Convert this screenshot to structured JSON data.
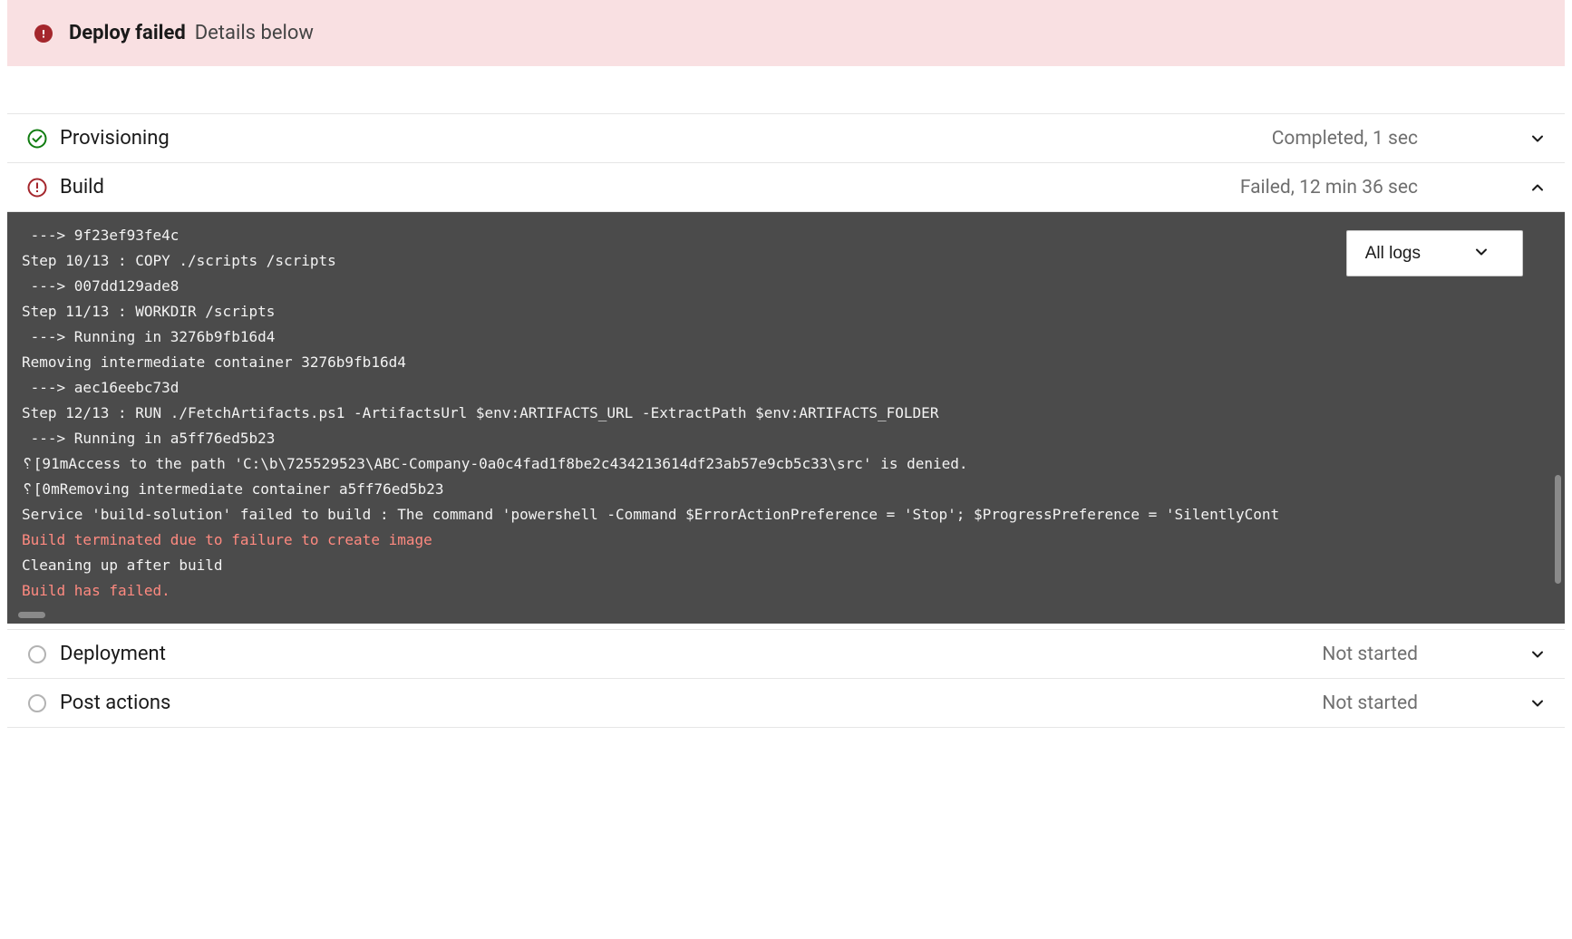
{
  "alert": {
    "title": "Deploy failed",
    "subtitle": "Details below"
  },
  "stages": {
    "provisioning": {
      "name": "Provisioning",
      "status": "Completed, 1 sec"
    },
    "build": {
      "name": "Build",
      "status": "Failed, 12 min 36 sec"
    },
    "deployment": {
      "name": "Deployment",
      "status": "Not started"
    },
    "postactions": {
      "name": "Post actions",
      "status": "Not started"
    }
  },
  "log_filter": {
    "selected": "All logs"
  },
  "log_lines": [
    {
      "t": " ---> 9f23ef93fe4c",
      "err": false
    },
    {
      "t": "Step 10/13 : COPY ./scripts /scripts",
      "err": false
    },
    {
      "t": " ---> 007dd129ade8",
      "err": false
    },
    {
      "t": "Step 11/13 : WORKDIR /scripts",
      "err": false
    },
    {
      "t": " ---> Running in 3276b9fb16d4",
      "err": false
    },
    {
      "t": "Removing intermediate container 3276b9fb16d4",
      "err": false
    },
    {
      "t": " ---> aec16eebc73d",
      "err": false
    },
    {
      "t": "Step 12/13 : RUN ./FetchArtifacts.ps1 -ArtifactsUrl $env:ARTIFACTS_URL -ExtractPath $env:ARTIFACTS_FOLDER",
      "err": false
    },
    {
      "t": " ---> Running in a5ff76ed5b23",
      "err": false
    },
    {
      "t": "␦[91mAccess to the path 'C:\\b\\725529523\\ABC-Company-0a0c4fad1f8be2c434213614df23ab57e9cb5c33\\src' is denied.",
      "err": false
    },
    {
      "t": "␦[0mRemoving intermediate container a5ff76ed5b23",
      "err": false
    },
    {
      "t": "Service 'build-solution' failed to build : The command 'powershell -Command $ErrorActionPreference = 'Stop'; $ProgressPreference = 'SilentlyCont",
      "err": false
    },
    {
      "t": "Build terminated due to failure to create image",
      "err": true
    },
    {
      "t": "Cleaning up after build",
      "err": false
    },
    {
      "t": "Build has failed.",
      "err": true
    }
  ],
  "colors": {
    "error": "#a4262c",
    "success": "#107c10",
    "banner_bg": "#f9e0e2"
  }
}
